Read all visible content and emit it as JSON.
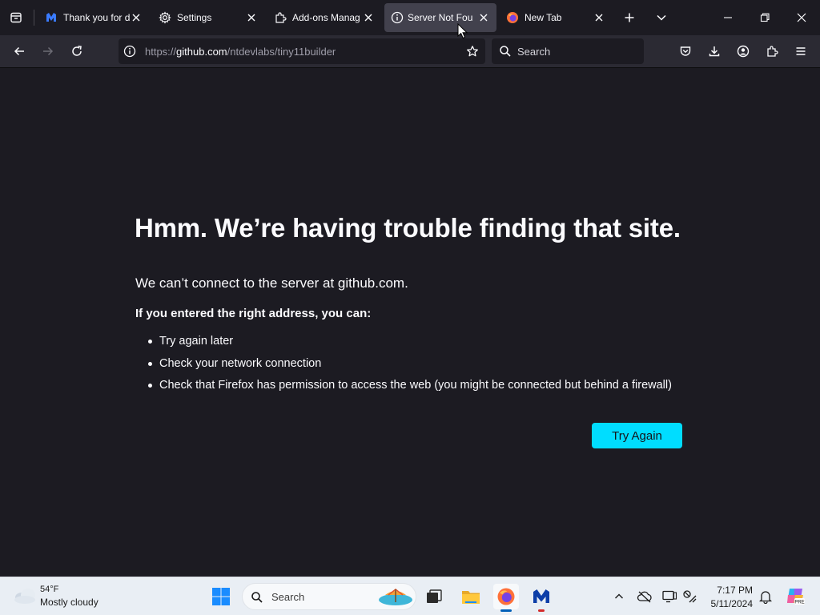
{
  "browser": {
    "tabs": [
      {
        "title": "Thank you for d",
        "favicon": "malwarebytes-icon",
        "active": false
      },
      {
        "title": "Settings",
        "favicon": "gear-icon",
        "active": false
      },
      {
        "title": "Add-ons Manag",
        "favicon": "puzzle-icon",
        "active": false
      },
      {
        "title": "Server Not Four",
        "favicon": "info-icon",
        "active": true
      },
      {
        "title": "New Tab",
        "favicon": "firefox-icon",
        "active": false
      }
    ],
    "url": {
      "scheme": "https://",
      "host": "github.com",
      "path": "/ntdevlabs/tiny11builder"
    },
    "search_placeholder": "Search"
  },
  "page": {
    "title": "Hmm. We’re having trouble finding that site.",
    "subtitle": "We can’t connect to the server at github.com.",
    "lead": "If you entered the right address, you can:",
    "items": [
      "Try again later",
      "Check your network connection",
      "Check that Firefox has permission to access the web (you might be connected but behind a firewall)"
    ],
    "button_label": "Try Again",
    "accent": "#00ddff"
  },
  "taskbar": {
    "weather": {
      "temp": "54°F",
      "desc": "Mostly cloudy"
    },
    "search_label": "Search",
    "clock": {
      "time": "7:17 PM",
      "date": "5/11/2024"
    }
  }
}
